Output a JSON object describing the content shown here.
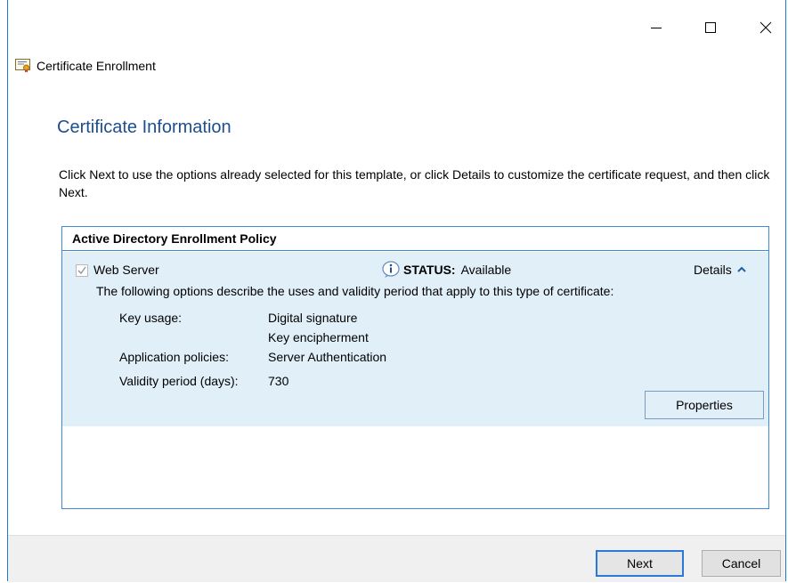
{
  "window": {
    "title": "Certificate Enrollment"
  },
  "page": {
    "heading": "Certificate Information",
    "instructions": "Click Next to use the options already selected for this template, or click Details to customize the certificate request, and then click Next."
  },
  "policy": {
    "header": "Active Directory Enrollment Policy",
    "item": {
      "name": "Web Server",
      "checked": true,
      "status_label": "STATUS:",
      "status_value": "Available",
      "details_label": "Details",
      "description": "The following options describe the uses and validity period that apply to this type of certificate:",
      "properties": [
        {
          "label": "Key usage:",
          "values": [
            "Digital signature",
            "Key encipherment"
          ]
        },
        {
          "label": "Application policies:",
          "values": [
            "Server Authentication"
          ]
        },
        {
          "label": "Validity period (days):",
          "values": [
            "730"
          ]
        }
      ],
      "properties_button": "Properties"
    }
  },
  "footer": {
    "next_label": "Next",
    "cancel_label": "Cancel"
  },
  "colors": {
    "heading": "#1e4e8c",
    "border_accent": "#3f8ad4",
    "item_bg": "#e1eff9"
  }
}
